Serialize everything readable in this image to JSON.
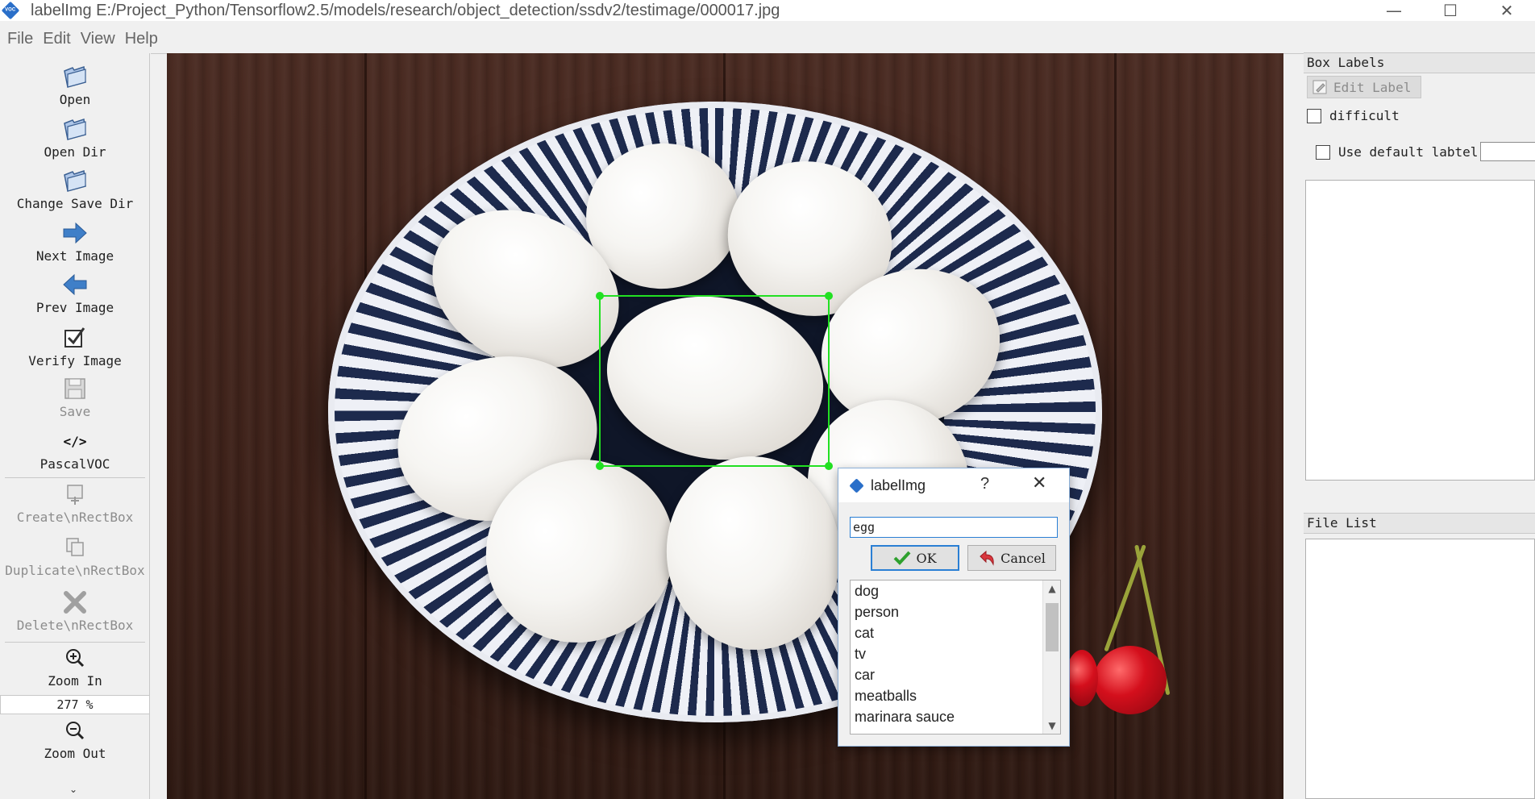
{
  "window": {
    "title": "labelImg E:/Project_Python/Tensorflow2.5/models/research/object_detection/ssdv2/testimage/000017.jpg",
    "minimize": "—",
    "maximize": "☐",
    "close": "✕"
  },
  "menu": [
    "File",
    "Edit",
    "View",
    "Help"
  ],
  "toolbar": {
    "open": "Open",
    "open_dir": "Open Dir",
    "change_save_dir": "Change Save Dir",
    "next_image": "Next Image",
    "prev_image": "Prev Image",
    "verify_image": "Verify Image",
    "save": "Save",
    "format_icon": "</>",
    "format": "PascalVOC",
    "create_rect": "Create\\nRectBox",
    "duplicate_rect": "Duplicate\\nRectBox",
    "delete_rect": "Delete\\nRectBox",
    "zoom_in": "Zoom In",
    "zoom_value": "277 %",
    "zoom_out": "Zoom Out",
    "more": "⌄"
  },
  "right_panel": {
    "box_labels_title": "Box Labels",
    "edit_label": "Edit Label",
    "difficult": "difficult",
    "use_default_label": "Use default labtel",
    "file_list_title": "File List"
  },
  "dialog": {
    "title": "labelImg",
    "help": "?",
    "close": "✕",
    "input_value": "egg",
    "ok": "OK",
    "cancel": "Cancel",
    "labels": [
      "dog",
      "person",
      "cat",
      "tv",
      "car",
      "meatballs",
      "marinara sauce"
    ]
  },
  "colors": {
    "bbox": "#22e022",
    "accent": "#2a7fd4"
  }
}
